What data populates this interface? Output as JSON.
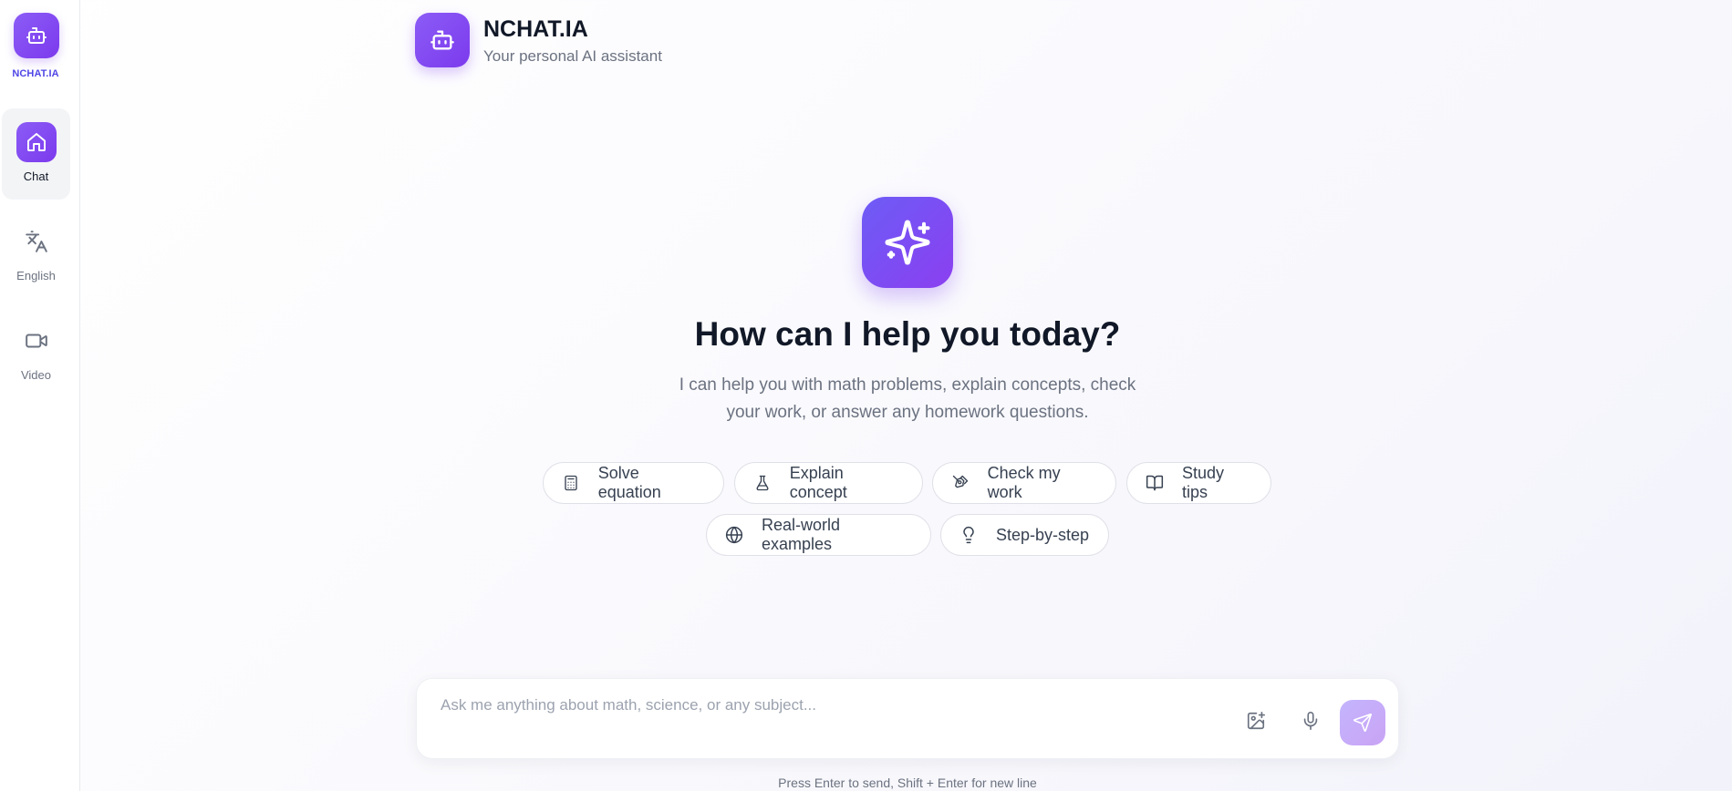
{
  "sidebar": {
    "brand": "NCHAT.IA",
    "items": [
      {
        "label": "Chat",
        "icon": "home-icon",
        "active": true
      },
      {
        "label": "English",
        "icon": "translate-icon",
        "active": false
      },
      {
        "label": "Video",
        "icon": "video-icon",
        "active": false
      }
    ]
  },
  "header": {
    "title": "NCHAT.IA",
    "subtitle": "Your personal AI assistant"
  },
  "hero": {
    "icon": "sparkles-icon",
    "title": "How can I help you today?",
    "description": "I can help you with math problems, explain concepts, check your work, or answer any homework questions."
  },
  "suggestions": [
    {
      "label": "Solve equation",
      "icon": "calculator-icon"
    },
    {
      "label": "Explain concept",
      "icon": "flask-icon"
    },
    {
      "label": "Check my work",
      "icon": "pen-icon"
    },
    {
      "label": "Study tips",
      "icon": "book-icon"
    },
    {
      "label": "Real-world examples",
      "icon": "globe-icon"
    },
    {
      "label": "Step-by-step",
      "icon": "lightbulb-icon"
    }
  ],
  "composer": {
    "placeholder": "Ask me anything about math, science, or any subject...",
    "value": "",
    "tools": [
      "image-upload-icon",
      "microphone-icon",
      "send-icon"
    ],
    "hint": "Press Enter to send, Shift + Enter for new line"
  },
  "colors": {
    "accent": "#7c3aed",
    "accent_light": "#8b5cf6",
    "brand_text": "#4f46e5",
    "send_disabled": "#c4b5fd"
  }
}
